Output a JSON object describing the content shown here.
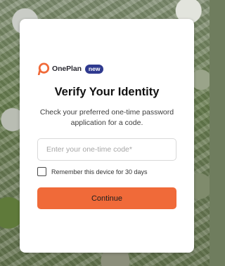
{
  "brand": {
    "name": "OnePlan",
    "badge": "new",
    "logo_icon": "oneplan-logo-icon",
    "accent_color": "#f06a39",
    "badge_color": "#2f3a8f"
  },
  "card": {
    "title": "Verify Your Identity",
    "subtitle": "Check your preferred one-time password application for a code."
  },
  "otp_field": {
    "value": "",
    "placeholder": "Enter your one-time code*"
  },
  "remember": {
    "label": "Remember this device for 30 days",
    "checked": false
  },
  "actions": {
    "continue_label": "Continue"
  }
}
